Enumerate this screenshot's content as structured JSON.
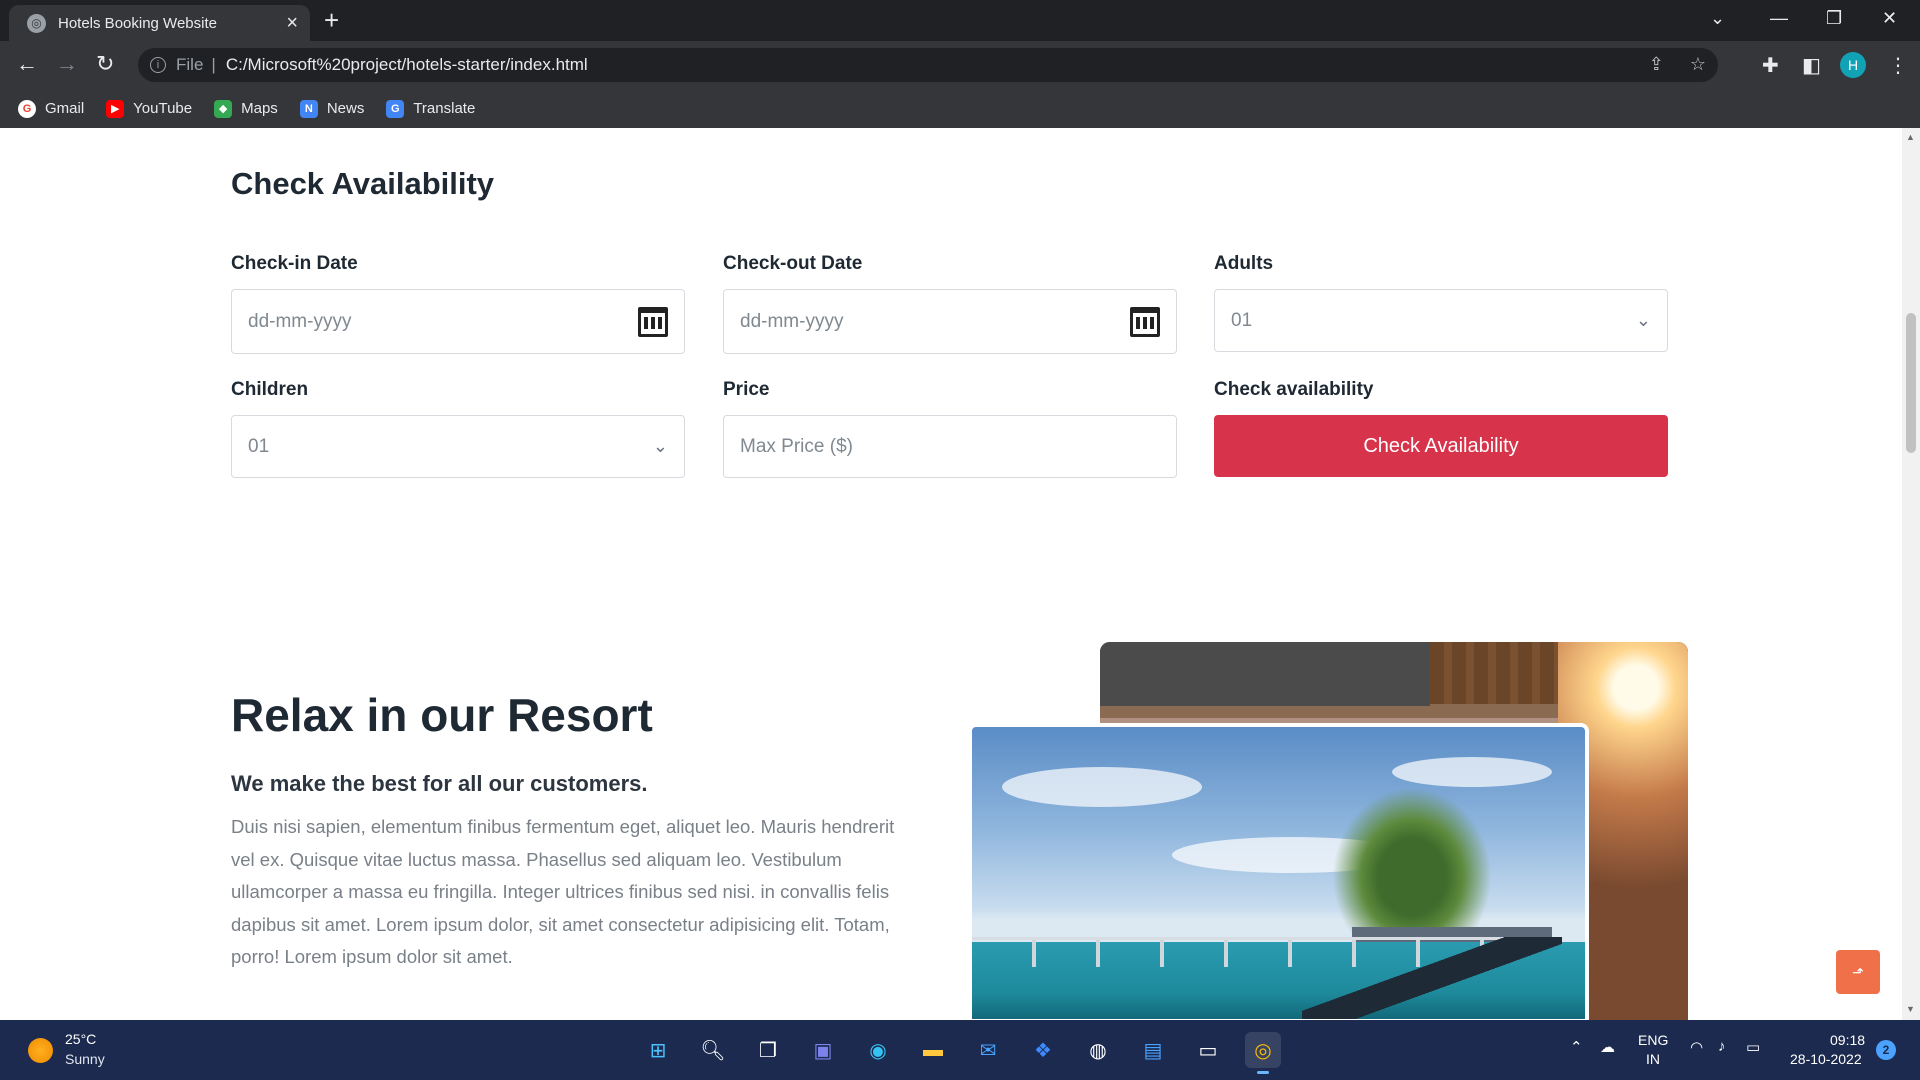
{
  "browser": {
    "tab_title": "Hotels Booking Website",
    "new_tab_symbol": "+",
    "url_scheme": "File",
    "url": "C:/Microsoft%20project/hotels-starter/index.html",
    "profile_initial": "H",
    "bookmarks": [
      {
        "label": "Gmail",
        "icon": "google-icon",
        "color": "#ea4335"
      },
      {
        "label": "YouTube",
        "icon": "youtube-icon",
        "color": "#ff0000"
      },
      {
        "label": "Maps",
        "icon": "maps-icon",
        "color": "#34a853"
      },
      {
        "label": "News",
        "icon": "news-icon",
        "color": "#4285f4"
      },
      {
        "label": "Translate",
        "icon": "translate-icon",
        "color": "#4285f4"
      }
    ]
  },
  "availability": {
    "title": "Check Availability",
    "checkin_label": "Check-in Date",
    "checkin_placeholder": "dd-mm-yyyy",
    "checkout_label": "Check-out Date",
    "checkout_placeholder": "dd-mm-yyyy",
    "adults_label": "Adults",
    "adults_value": "01",
    "children_label": "Children",
    "children_value": "01",
    "price_label": "Price",
    "price_placeholder": "Max Price ($)",
    "check_label": "Check availability",
    "check_button": "Check Availability",
    "accent_color": "#d7334a"
  },
  "resort": {
    "title": "Relax in our Resort",
    "subtitle": "We make the best for all our customers.",
    "body": "Duis nisi sapien, elementum finibus fermentum eget, aliquet leo. Mauris hendrerit vel ex. Quisque vitae luctus massa. Phasellus sed aliquam leo. Vestibulum ullamcorper a massa eu fringilla. Integer ultrices finibus sed nisi. in convallis felis dapibus sit amet. Lorem ipsum dolor, sit amet consectetur adipisicing elit. Totam, porro! Lorem ipsum dolor sit amet."
  },
  "taskbar": {
    "temperature": "25°C",
    "condition": "Sunny",
    "lang_line1": "ENG",
    "lang_line2": "IN",
    "time": "09:18",
    "date": "28-10-2022",
    "notifications": "2"
  }
}
